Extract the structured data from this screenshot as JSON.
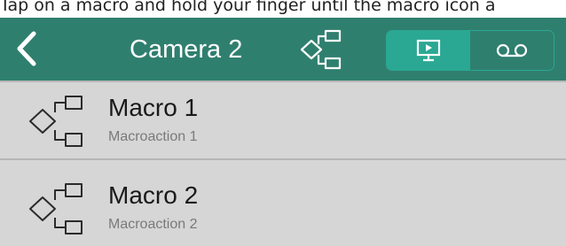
{
  "caption": "Tap on a macro and hold your finger until the macro icon a",
  "navbar": {
    "back_icon": "chevron-left-icon",
    "title": "Camera 2",
    "macro_icon": "macro-icon",
    "segments": [
      {
        "icon": "monitor-icon",
        "active": true
      },
      {
        "icon": "recording-icon",
        "active": false
      }
    ],
    "colors": {
      "bar": "#2f7f6f",
      "active_segment": "#2aa893"
    }
  },
  "macros": [
    {
      "title": "Macro 1",
      "subtitle": "Macroaction 1",
      "icon": "macro-icon"
    },
    {
      "title": "Macro 2",
      "subtitle": "Macroaction 2",
      "icon": "macro-icon"
    }
  ]
}
